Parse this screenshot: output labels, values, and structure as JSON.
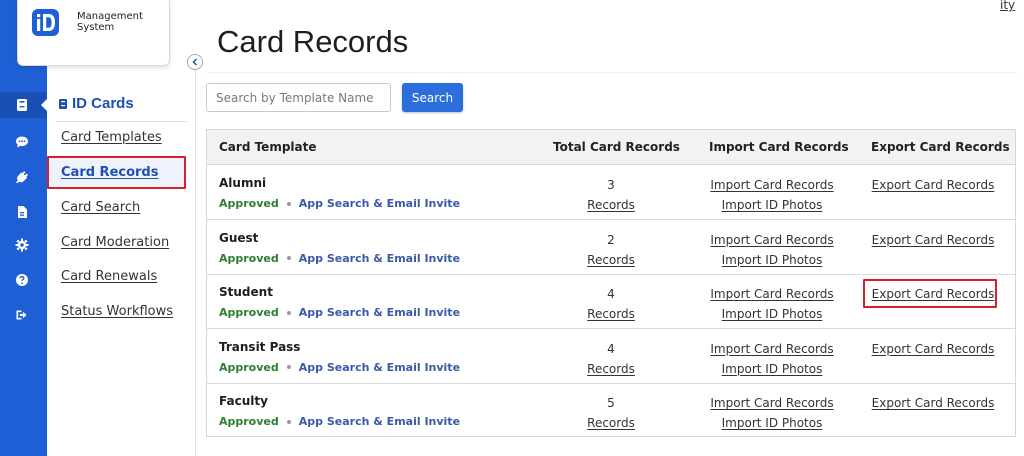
{
  "app": {
    "logo_text": "Management System",
    "top_right_link": "ity"
  },
  "rail": {
    "icons": [
      "id-card-icon",
      "chat-icon",
      "plug-icon",
      "document-icon",
      "gear-icon",
      "help-icon",
      "logout-icon"
    ],
    "active_index": 0
  },
  "submenu": {
    "heading": "ID Cards",
    "items": [
      {
        "label": "Card Templates",
        "active": false
      },
      {
        "label": "Card Records",
        "active": true
      },
      {
        "label": "Card Search",
        "active": false
      },
      {
        "label": "Card Moderation",
        "active": false
      },
      {
        "label": "Card Renewals",
        "active": false
      },
      {
        "label": "Status Workflows",
        "active": false
      }
    ]
  },
  "main": {
    "title": "Card Records",
    "search": {
      "placeholder": "Search by Template Name",
      "value": "",
      "button_label": "Search"
    },
    "table": {
      "headers": [
        "Card Template",
        "Total Card Records",
        "Import Card Records",
        "Export Card Records"
      ],
      "rows": [
        {
          "name": "Alumni",
          "status": "Approved",
          "feature": "App Search & Email Invite",
          "count": "3",
          "records_link": "Records",
          "import_link": "Import Card Records",
          "import_photos_link": "Import ID Photos",
          "export_link": "Export Card Records",
          "highlighted": false
        },
        {
          "name": "Guest",
          "status": "Approved",
          "feature": "App Search & Email Invite",
          "count": "2",
          "records_link": "Records",
          "import_link": "Import Card Records",
          "import_photos_link": "Import ID Photos",
          "export_link": "Export Card Records",
          "highlighted": false
        },
        {
          "name": "Student",
          "status": "Approved",
          "feature": "App Search & Email Invite",
          "count": "4",
          "records_link": "Records",
          "import_link": "Import Card Records",
          "import_photos_link": "Import ID Photos",
          "export_link": "Export Card Records",
          "highlighted": true
        },
        {
          "name": "Transit Pass",
          "status": "Approved",
          "feature": "App Search & Email Invite",
          "count": "4",
          "records_link": "Records",
          "import_link": "Import Card Records",
          "import_photos_link": "Import ID Photos",
          "export_link": "Export Card Records",
          "highlighted": false
        },
        {
          "name": "Faculty",
          "status": "Approved",
          "feature": "App Search & Email Invite",
          "count": "5",
          "records_link": "Records",
          "import_link": "Import Card Records",
          "import_photos_link": "Import ID Photos",
          "export_link": "Export Card Records",
          "highlighted": false
        }
      ]
    }
  },
  "colors": {
    "rail": "#1f5fd6",
    "accent": "#1f4fb0",
    "button": "#2c6fdc",
    "highlight_border": "#d8202a",
    "approved": "#2e7d32",
    "feature": "#3a5aa8"
  }
}
